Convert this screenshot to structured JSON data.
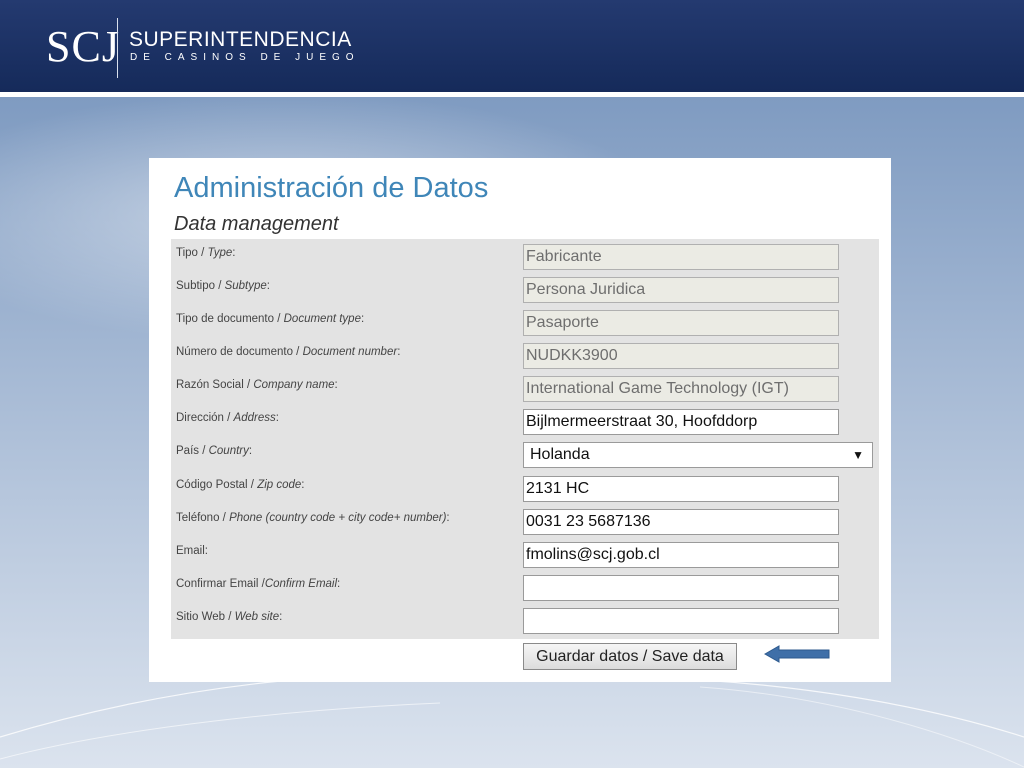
{
  "header": {
    "logo_mark": "SCJ",
    "title": "SUPERINTENDENCIA",
    "subtitle": "DE CASINOS DE JUEGO"
  },
  "page": {
    "title": "Administración de Datos",
    "subtitle": "Data management"
  },
  "form": {
    "fields": [
      {
        "label_es": "Tipo / ",
        "label_en": "Type",
        "label_tail": ":",
        "value": "Fabricante",
        "readonly": true
      },
      {
        "label_es": "Subtipo / ",
        "label_en": "Subtype",
        "label_tail": ":",
        "value": "Persona Juridica",
        "readonly": true
      },
      {
        "label_es": "Tipo de documento / ",
        "label_en": "Document type",
        "label_tail": ":",
        "value": "Pasaporte",
        "readonly": true
      },
      {
        "label_es": "Número de documento / ",
        "label_en": "Document number",
        "label_tail": ":",
        "value": "NUDKK3900",
        "readonly": true
      },
      {
        "label_es": "Razón Social / ",
        "label_en": "Company name",
        "label_tail": ":",
        "value": "International Game Technology (IGT)",
        "readonly": true
      },
      {
        "label_es": "Dirección / ",
        "label_en": "Address",
        "label_tail": ":",
        "value": "Bijlmermeerstraat 30, Hoofddorp",
        "readonly": false
      },
      {
        "label_es": "País / ",
        "label_en": "Country",
        "label_tail": ":",
        "value": "Holanda",
        "type": "select"
      },
      {
        "label_es": "Código Postal / ",
        "label_en": "Zip code",
        "label_tail": ":",
        "value": "2131 HC",
        "readonly": false
      },
      {
        "label_es": "Teléfono / ",
        "label_en": "Phone (country code + city code+ number)",
        "label_tail": ":",
        "value": "0031 23 5687136",
        "readonly": false
      },
      {
        "label_es": "Email",
        "label_en": "",
        "label_tail": ":",
        "value": "fmolins@scj.gob.cl",
        "readonly": false
      },
      {
        "label_es": "Confirmar Email /",
        "label_en": "Confirm Email",
        "label_tail": ":",
        "value": "",
        "readonly": false
      },
      {
        "label_es": "Sitio Web / ",
        "label_en": "Web site",
        "label_tail": ":",
        "value": "",
        "readonly": false
      }
    ],
    "save_label": "Guardar datos / Save data"
  },
  "icons": {
    "dropdown": "triangle-down-icon",
    "pointer": "left-arrow-icon"
  },
  "colors": {
    "header_bg": "#1c3264",
    "title": "#3f86b8",
    "form_bg": "#e3e3e3",
    "readonly_bg": "#ebebe4",
    "arrow": "#3f6fa8"
  }
}
